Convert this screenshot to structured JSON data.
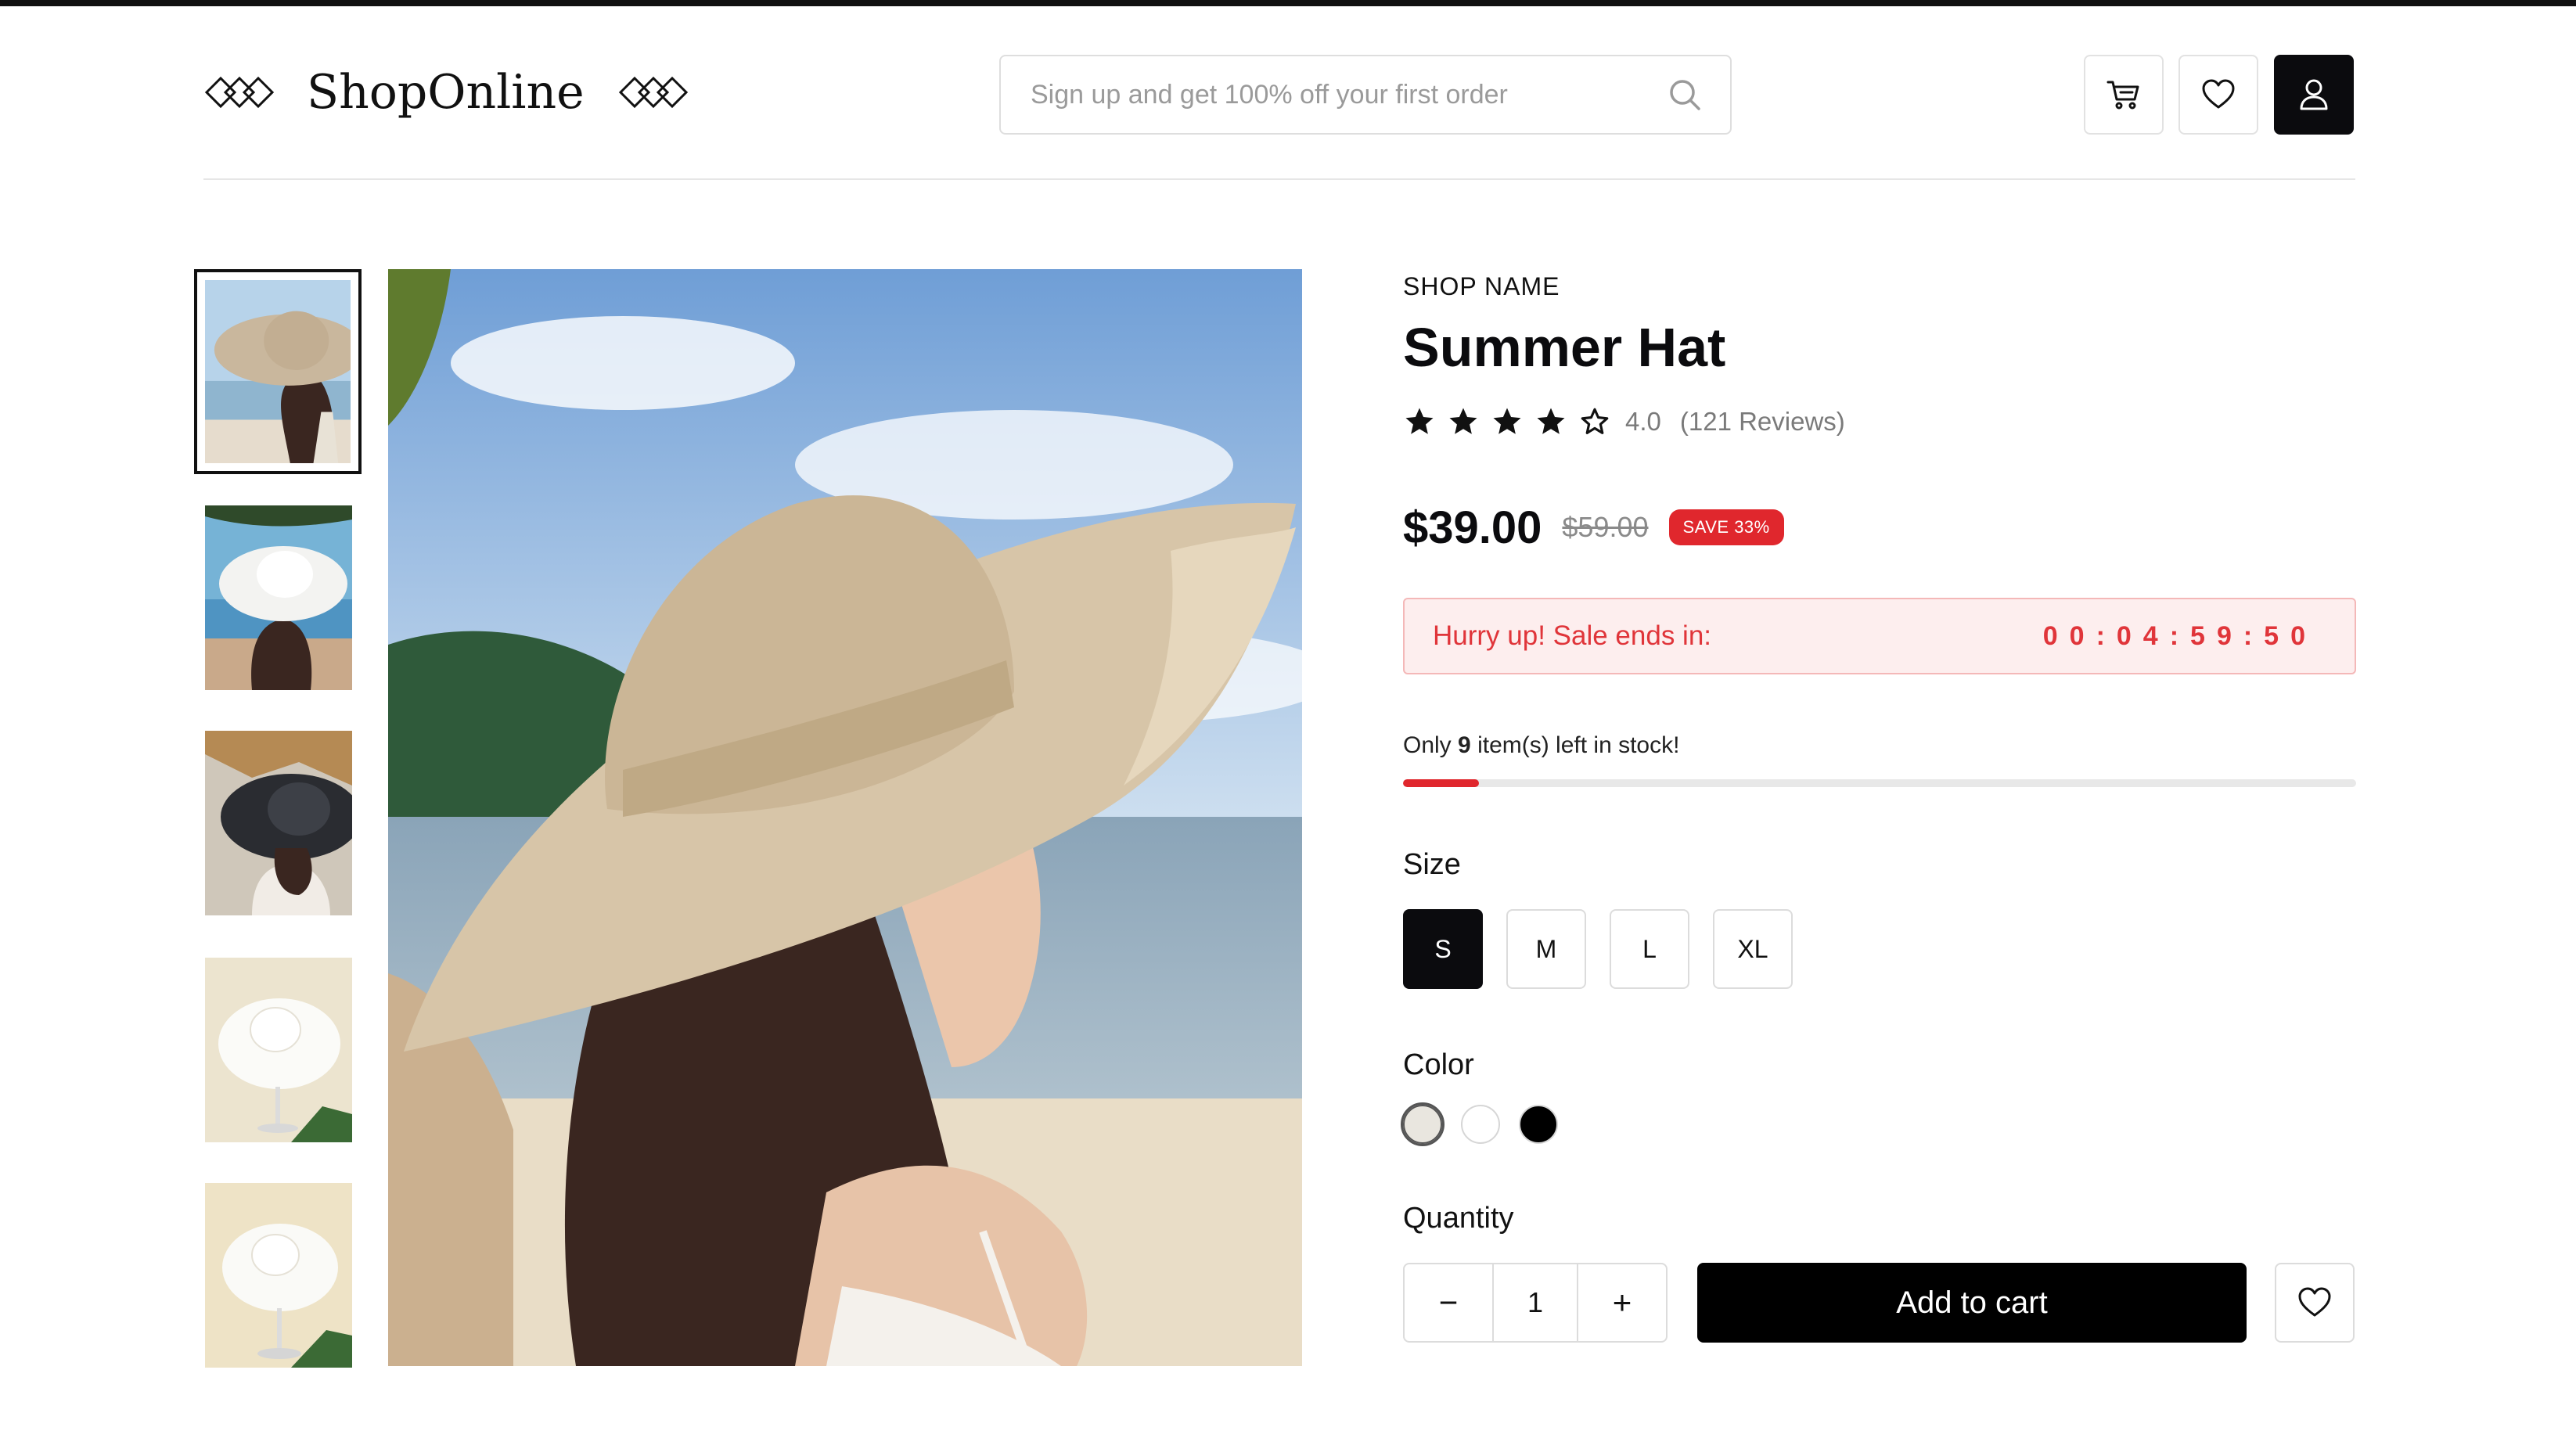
{
  "header": {
    "logo_text": "ShopOnline",
    "search_placeholder": "Sign up and get 100% off your first order",
    "icons": [
      "cart-icon",
      "heart-icon",
      "user-icon"
    ]
  },
  "gallery": {
    "thumbnails": [
      {
        "label": "beige straw hat, beach"
      },
      {
        "label": "white hat, beach"
      },
      {
        "label": "black hat, hut"
      },
      {
        "label": "white hat on stand"
      },
      {
        "label": "white hat on stand 2"
      }
    ],
    "selected_index": 0
  },
  "product": {
    "shop_name": "SHOP NAME",
    "title": "Summer Hat",
    "rating": 4,
    "rating_max": 5,
    "rating_text": "4.0",
    "reviews_text": "(121 Reviews)",
    "price": "$39.00",
    "old_price": "$59.00",
    "save_badge": "SAVE 33%",
    "sale_label": "Hurry up! Sale ends in:",
    "sale_timer": "00:04:59:50",
    "stock_prefix": "Only",
    "stock_count": "9",
    "stock_suffix": "item(s) left in stock!",
    "stock_fraction": 0.08,
    "size_label": "Size",
    "sizes": [
      "S",
      "M",
      "L",
      "XL"
    ],
    "selected_size": "S",
    "color_label": "Color",
    "colors": [
      "#e9e6df",
      "#ffffff",
      "#000000"
    ],
    "selected_color_index": 0,
    "quantity_label": "Quantity",
    "quantity": "1",
    "minus": "−",
    "plus": "+",
    "add_to_cart": "Add to cart"
  },
  "colors": {
    "accent_red": "#e0272d",
    "primary_dark": "#0b0b0e"
  }
}
